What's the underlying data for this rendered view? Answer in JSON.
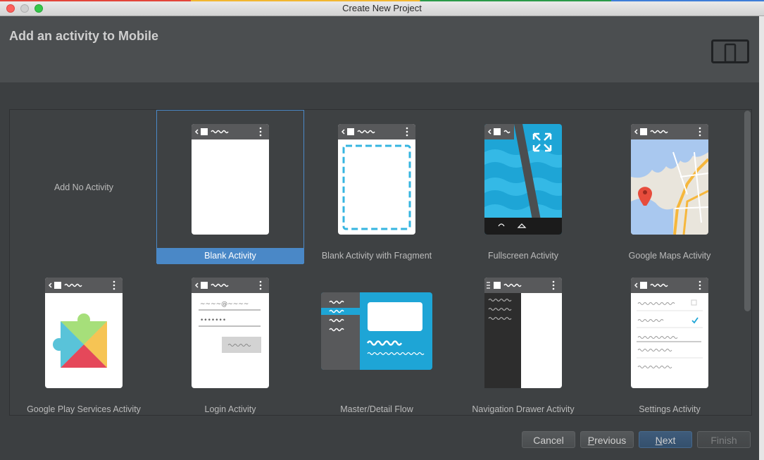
{
  "window": {
    "title": "Create New Project",
    "color_strip": [
      "#e2463a",
      "#f2b731",
      "#2a9a48",
      "#3d7dd8"
    ]
  },
  "header": {
    "title": "Add an activity to Mobile",
    "form_factor_icon": "phone-tablet-icon"
  },
  "gallery": {
    "selected": "Blank Activity",
    "tiles": [
      {
        "label": "Add No Activity"
      },
      {
        "label": "Blank Activity"
      },
      {
        "label": "Blank Activity with Fragment"
      },
      {
        "label": "Fullscreen Activity"
      },
      {
        "label": "Google Maps Activity"
      },
      {
        "label": "Google Play Services Activity"
      },
      {
        "label": "Login Activity"
      },
      {
        "label": "Master/Detail Flow"
      },
      {
        "label": "Navigation Drawer Activity"
      },
      {
        "label": "Settings Activity"
      }
    ],
    "login_preview": {
      "email_placeholder": "~~~~@~~~~",
      "password_placeholder": "•••••••"
    }
  },
  "buttons": {
    "cancel": "Cancel",
    "previous_mnemonic": "P",
    "previous_rest": "revious",
    "next_mnemonic": "N",
    "next_rest": "ext",
    "finish": "Finish"
  },
  "colors": {
    "selection": "#4a88c7",
    "accent_blue": "#1ea5d6",
    "dialog_bg": "#3c3f41"
  }
}
